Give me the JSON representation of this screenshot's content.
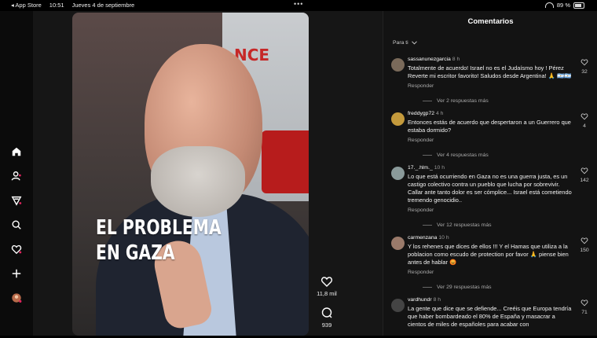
{
  "status_bar": {
    "app_back": "◂ App Store",
    "time": "10:51",
    "date": "Jueves 4 de septiembre",
    "dots": "•••",
    "battery": "89 %"
  },
  "nav": [
    "home-icon",
    "following-icon",
    "explore-icon",
    "search-icon",
    "activity-icon",
    "create-icon",
    "profile-avatar"
  ],
  "video": {
    "overlay_title_line1": "EL PROBLEMA",
    "overlay_title_line2": "EN GAZA",
    "likes": "11,8 mil",
    "comments": "939"
  },
  "comments_panel": {
    "title": "Comentarios",
    "sort_label": "Para ti",
    "items": [
      {
        "user": "sassanunezgarcia",
        "time": "8 h",
        "text": "Totalmente de acuerdo! Israel no es el Judaísmo hoy ! Pérez Reverte mi escritor favorito! Saludos desde Argentina! 🙏 🇦🇷🇦🇷",
        "reply": "Responder",
        "more": "Ver 2 respuestas más",
        "likes": "32",
        "avatar_color": "#7a6a5a"
      },
      {
        "user": "freddygp72",
        "time": "4 h",
        "text": "Entonces estás de acuerdo que despertaron a un Guerrero que estaba dormido?",
        "reply": "Responder",
        "more": "Ver 4 respuestas más",
        "likes": "4",
        "avatar_color": "#c49a3c"
      },
      {
        "user": "17._.hlm._",
        "time": "10 h",
        "text": "Lo que está ocurriendo en Gaza no es una guerra justa, es un castigo colectivo contra un pueblo que lucha por sobrevivir. Callar ante tanto dolor es ser cómplice... Israel está cometiendo tremendo genocidio..",
        "reply": "Responder",
        "more": "Ver 12 respuestas más",
        "likes": "142",
        "avatar_color": "#8a9a9a"
      },
      {
        "user": "carmenzana",
        "time": "10 h",
        "text": "Y los rehenes que dices de ellos !!! Y el Hamas que utiliza a la poblacion como escudo de protection por favor 🙏 piense bien antes de hablar 😡",
        "reply": "Responder",
        "more": "Ver 29 respuestas más",
        "likes": "150",
        "avatar_color": "#9a7a6a"
      },
      {
        "user": "vardhundr",
        "time": "8 h",
        "text": "La gente que dice que se defiende... Creéis que Europa tendría que haber bombardeado el 80% de España y masacrar a cientos de miles de españoles para acabar con",
        "reply": "",
        "more": "",
        "likes": "71",
        "avatar_color": "#444444"
      }
    ]
  }
}
